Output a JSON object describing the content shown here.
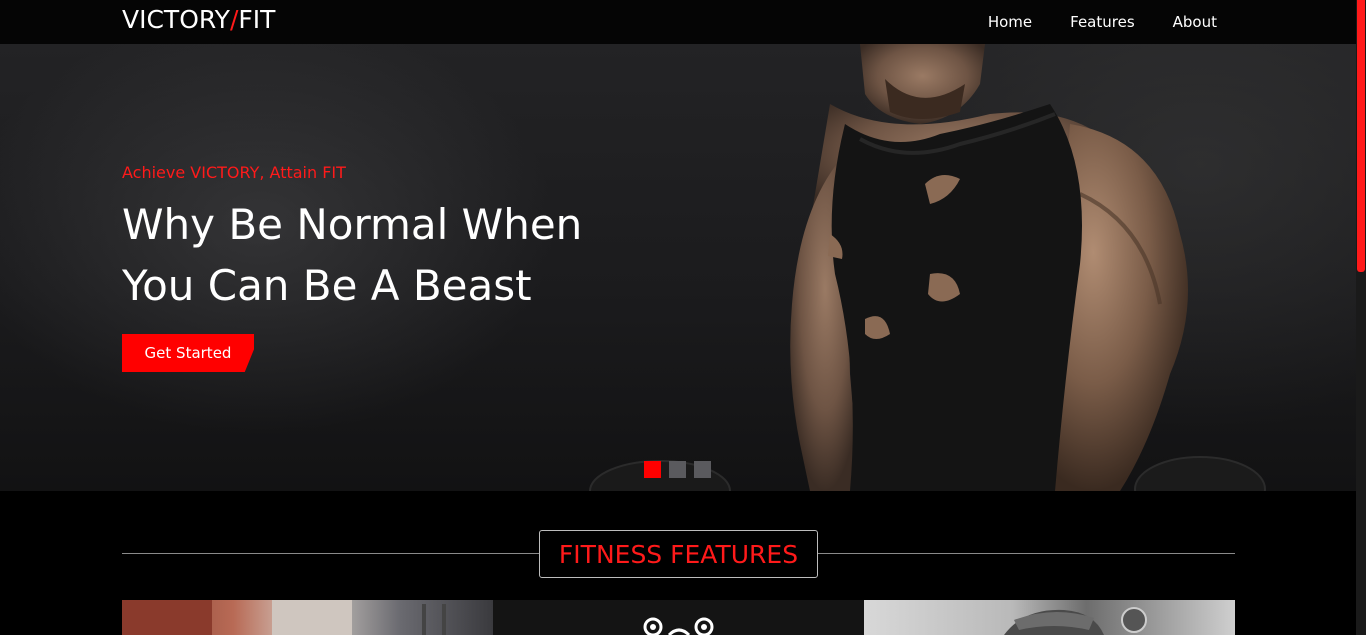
{
  "brand": {
    "part1": "VICTORY",
    "slash": "/",
    "part2": "FIT",
    "accent": "#ff1a1a"
  },
  "nav": {
    "items": [
      "Home",
      "Features",
      "About"
    ]
  },
  "hero": {
    "subtitle": "Achieve VICTORY, Attain FIT",
    "title_line1": "Why Be Normal When",
    "title_line2": "You Can Be A Beast",
    "cta_label": "Get Started",
    "slides": {
      "count": 3,
      "active": 1
    },
    "image_icon": "muscular-man-photo"
  },
  "features": {
    "heading": "FITNESS FEATURES",
    "cards": [
      {
        "icon": "gym-training-photo"
      },
      {
        "icon": "dumbbell-icon"
      },
      {
        "icon": "athlete-photo"
      }
    ]
  },
  "colors": {
    "accent": "#ff0000",
    "background": "#000000",
    "dot_inactive": "#5a5a5e"
  }
}
